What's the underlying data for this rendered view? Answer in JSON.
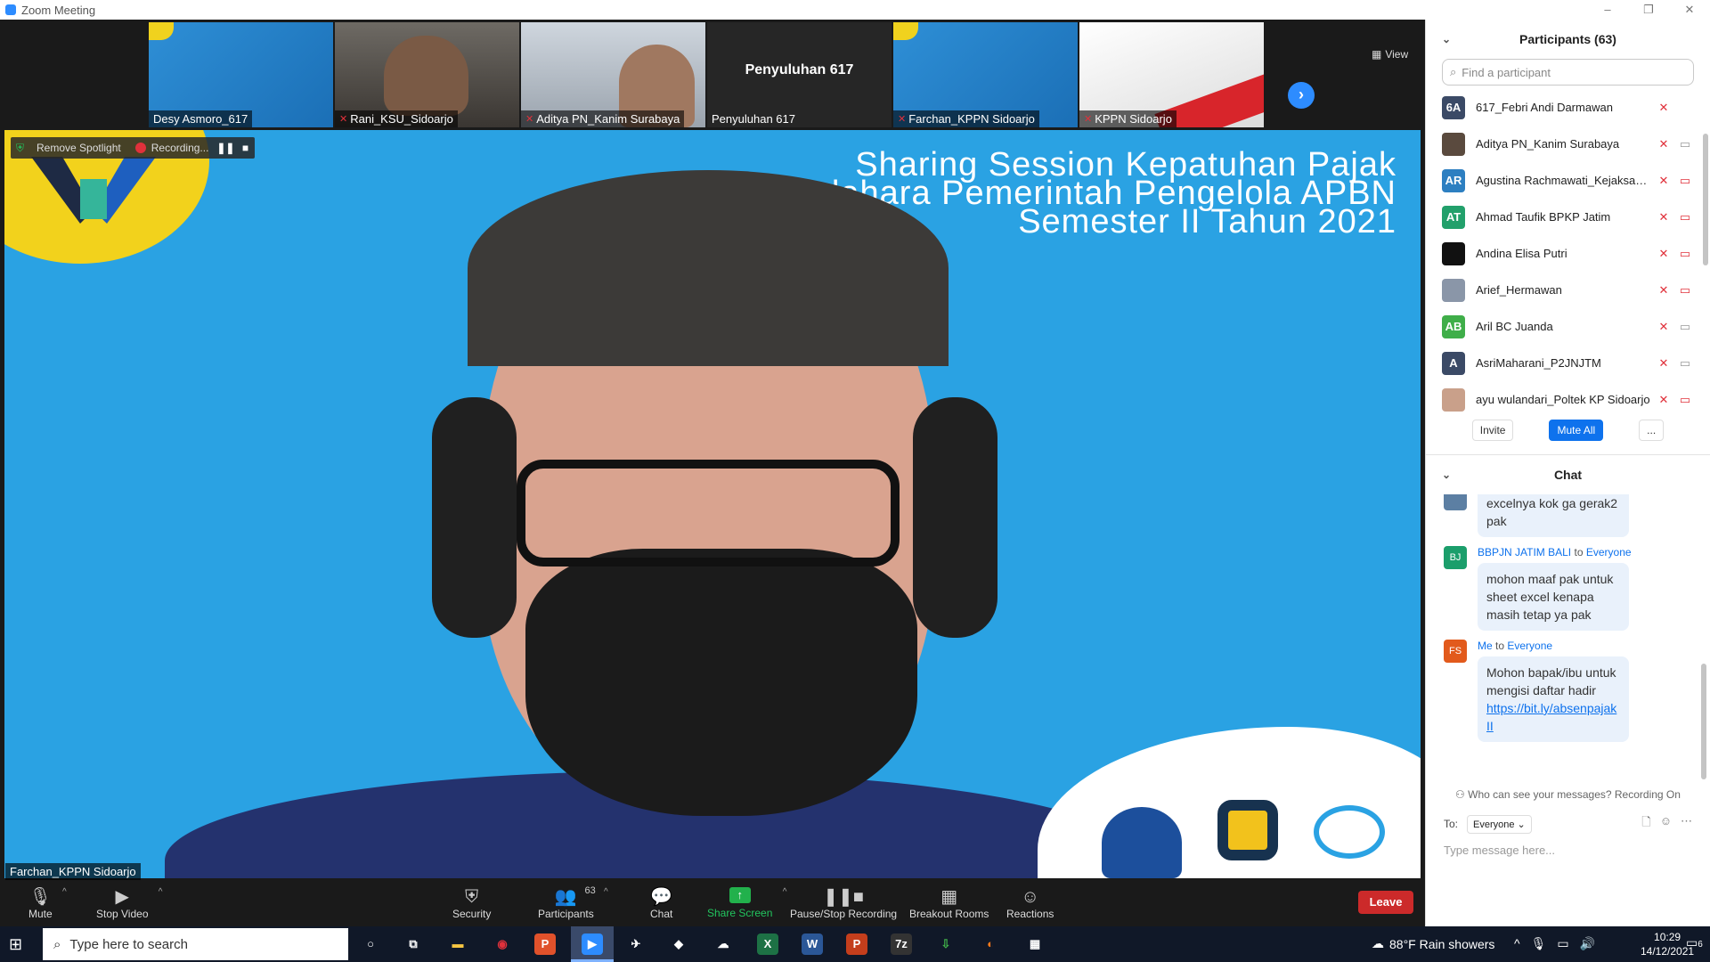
{
  "window": {
    "title": "Zoom Meeting",
    "controls": [
      "–",
      "❐",
      "✕"
    ]
  },
  "filmstrip": {
    "tiles": [
      {
        "name": "Desy Asmoro_617",
        "muted": false,
        "style": "blue"
      },
      {
        "name": "Rani_KSU_Sidoarjo",
        "muted": true,
        "style": "room"
      },
      {
        "name": "Aditya PN_Kanim Surabaya",
        "muted": true,
        "style": "bldg"
      },
      {
        "name": "Penyuluhan 617",
        "muted": false,
        "style": "dark",
        "big_name": "Penyuluhan 617"
      },
      {
        "name": "Farchan_KPPN Sidoarjo",
        "muted": true,
        "style": "blue"
      },
      {
        "name": "KPPN Sidoarjo",
        "muted": true,
        "style": "white"
      }
    ],
    "next_icon": "chevron-right-icon",
    "view_label": "View"
  },
  "main_video": {
    "slide_lines": [
      "Sharing Session Kepatuhan Pajak",
      "Bendahara Pemerintah Pengelola APBN",
      "Semester II Tahun 2021"
    ],
    "speaker_label": "Farchan_KPPN Sidoarjo",
    "logos": [
      "djp-logo",
      "dip-logo",
      "djpb-logo"
    ]
  },
  "recording_bar": {
    "remove_spotlight": "Remove Spotlight",
    "recording": "Recording...",
    "pause_icon": "pause-icon",
    "stop_icon": "stop-icon"
  },
  "toolbar": {
    "mute": "Mute",
    "stop_video": "Stop Video",
    "security": "Security",
    "participants": "Participants",
    "participants_count": "63",
    "chat": "Chat",
    "share_screen": "Share Screen",
    "pause_stop_recording": "Pause/Stop Recording",
    "breakout_rooms": "Breakout Rooms",
    "reactions": "Reactions",
    "leave": "Leave"
  },
  "participants_panel": {
    "title": "Participants (63)",
    "search_placeholder": "Find a participant",
    "list": [
      {
        "initials": "6A",
        "name": "617_Febri Andi Darmawan",
        "avatar_color": "#3b4a66",
        "cam": "none"
      },
      {
        "initials": "",
        "name": "Aditya PN_Kanim Surabaya",
        "avatar_color": "#5a4a3e",
        "cam": "on"
      },
      {
        "initials": "AR",
        "name": "Agustina Rachmawati_Kejaksaan...",
        "avatar_color": "#2d7fc1",
        "cam": "off"
      },
      {
        "initials": "AT",
        "name": "Ahmad Taufik BPKP Jatim",
        "avatar_color": "#22a06b",
        "cam": "off"
      },
      {
        "initials": "",
        "name": "Andina Elisa Putri",
        "avatar_color": "#111111",
        "cam": "off"
      },
      {
        "initials": "",
        "name": "Arief_Hermawan",
        "avatar_color": "#8a96a8",
        "cam": "off"
      },
      {
        "initials": "AB",
        "name": "Aril BC Juanda",
        "avatar_color": "#3fae49",
        "cam": "on"
      },
      {
        "initials": "A",
        "name": "AsriMaharani_P2JNJTM",
        "avatar_color": "#3b4a66",
        "cam": "on"
      },
      {
        "initials": "",
        "name": "ayu wulandari_Poltek KP Sidoarjo",
        "avatar_color": "#c9a08a",
        "cam": "off"
      }
    ],
    "invite": "Invite",
    "mute_all": "Mute All",
    "more": "..."
  },
  "chat_panel": {
    "title": "Chat",
    "messages": [
      {
        "avatar": "",
        "avatar_color": "#5c7fa3",
        "sender": "",
        "to_word": "",
        "recipient": "",
        "text": "excelnya kok ga gerak2 pak",
        "link": ""
      },
      {
        "avatar": "BJ",
        "avatar_color": "#1b9e6b",
        "sender": "BBPJN JATIM BALI",
        "to_word": "to",
        "recipient": "Everyone",
        "text": "mohon maaf pak untuk sheet excel kenapa masih tetap ya pak",
        "link": ""
      },
      {
        "avatar": "FS",
        "avatar_color": "#e25a1c",
        "sender": "Me",
        "to_word": "to",
        "recipient": "Everyone",
        "text": "Mohon bapak/ibu untuk mengisi daftar hadir",
        "link": "https://bit.ly/absenpajakII"
      }
    ],
    "who_can_see": "Who can see your messages? Recording On",
    "to_label": "To:",
    "to_value": "Everyone",
    "input_placeholder": "Type message here..."
  },
  "taskbar": {
    "search_placeholder": "Type here to search",
    "weather": "88°F  Rain showers",
    "time": "10:29",
    "date": "14/12/2021",
    "notifications": "6"
  }
}
